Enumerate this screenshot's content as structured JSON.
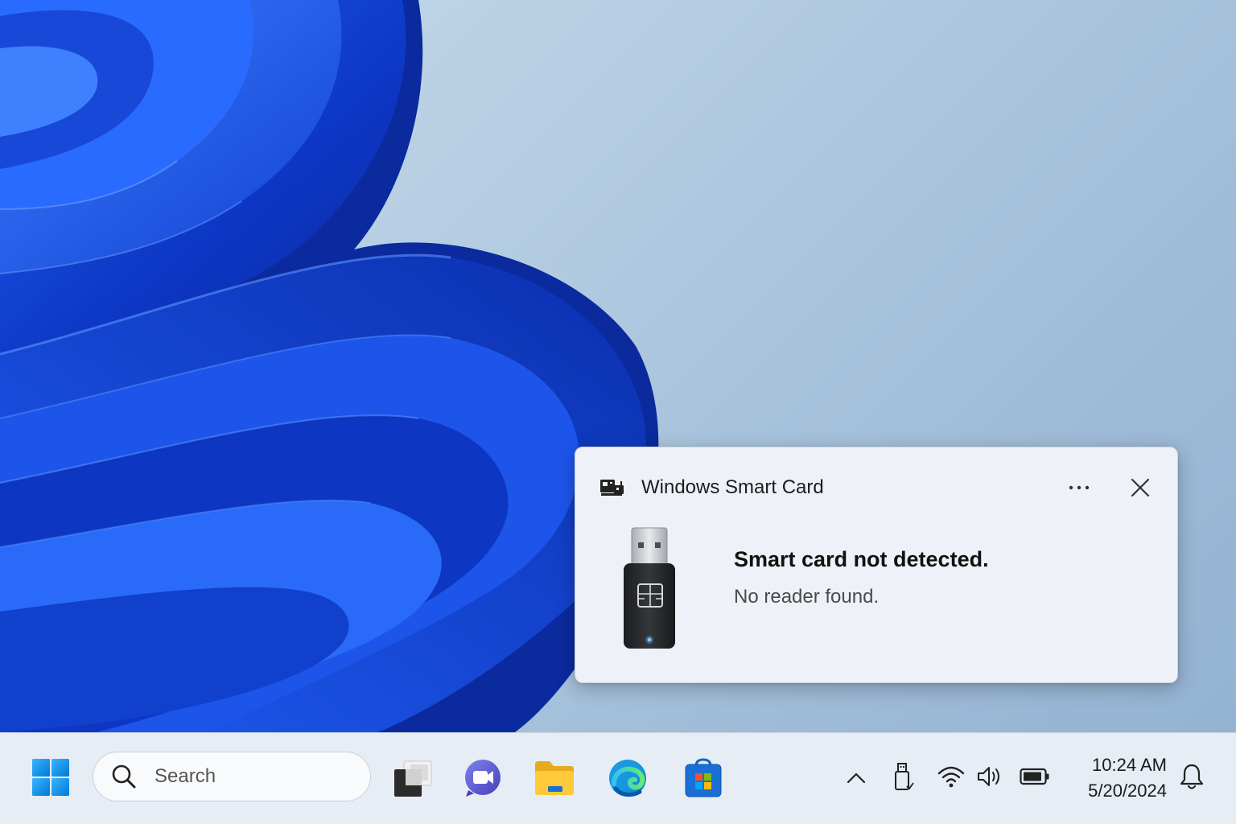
{
  "notification": {
    "app_name": "Windows Smart Card",
    "title": "Smart card not detected.",
    "body": "No reader found.",
    "more_icon": "more-horizontal-icon",
    "close_icon": "close-icon",
    "image": "usb-smart-card-reader-icon"
  },
  "taskbar": {
    "start_icon": "windows-start-icon",
    "search_placeholder": "Search",
    "pinned_apps": [
      {
        "icon": "task-view-icon"
      },
      {
        "icon": "teams-meet-icon"
      },
      {
        "icon": "file-explorer-icon"
      },
      {
        "icon": "edge-icon"
      },
      {
        "icon": "microsoft-store-icon"
      }
    ],
    "tray": {
      "icons": [
        "chevron-up-icon",
        "usb-device-icon",
        "wifi-icon",
        "volume-icon",
        "battery-icon",
        "bell-icon"
      ],
      "time": "10:24 AM",
      "date": "5/20/2024"
    }
  },
  "colors": {
    "accent": "#0067c0",
    "wallpaper_blue": "#1646d6",
    "desktop_bg": "#b2cbe1"
  }
}
